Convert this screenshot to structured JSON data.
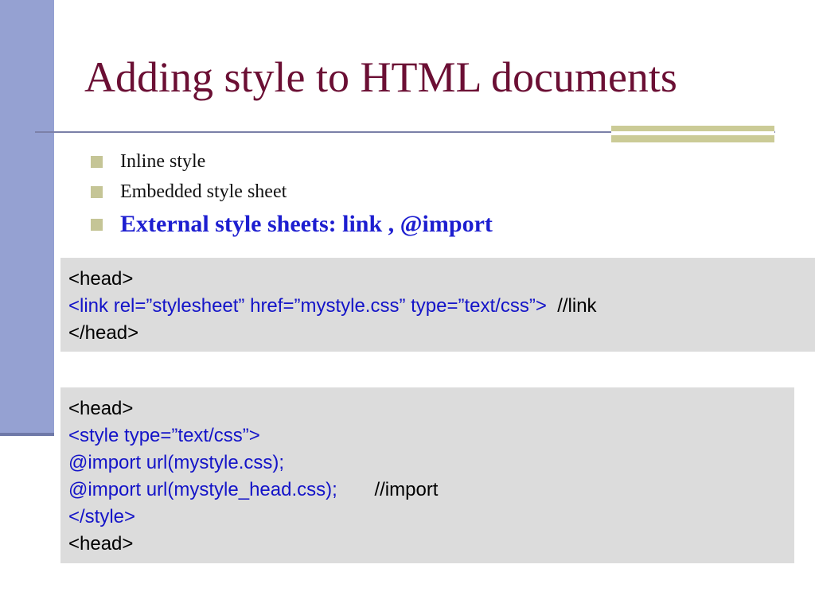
{
  "slide": {
    "title": "Adding style to HTML documents",
    "bullets": [
      {
        "label": "Inline style"
      },
      {
        "label": "Embedded style sheet"
      },
      {
        "label": "External style sheets: link , @import"
      }
    ]
  },
  "code_block_link": {
    "line1": "<head>",
    "line2_code": "<link rel=”stylesheet” href=”mystyle.css” type=”text/css”>",
    "line2_comment": "  //link",
    "line3": "</head>"
  },
  "code_block_import": {
    "line1": "<head>",
    "line2": "<style type=”text/css”>",
    "line3": "@import url(mystyle.css);",
    "line4_code": "@import url(mystyle_head.css);",
    "line4_comment": "       //import",
    "line5": "</style>",
    "line6": "<head>"
  },
  "colors": {
    "title": "#6b0f34",
    "left_bar": "#95a1d2",
    "accent": "#cbcb96",
    "code_blue": "#1414c8",
    "code_box_bg": "#dcdcdc",
    "highlight_bullet": "#1d1ed0"
  }
}
